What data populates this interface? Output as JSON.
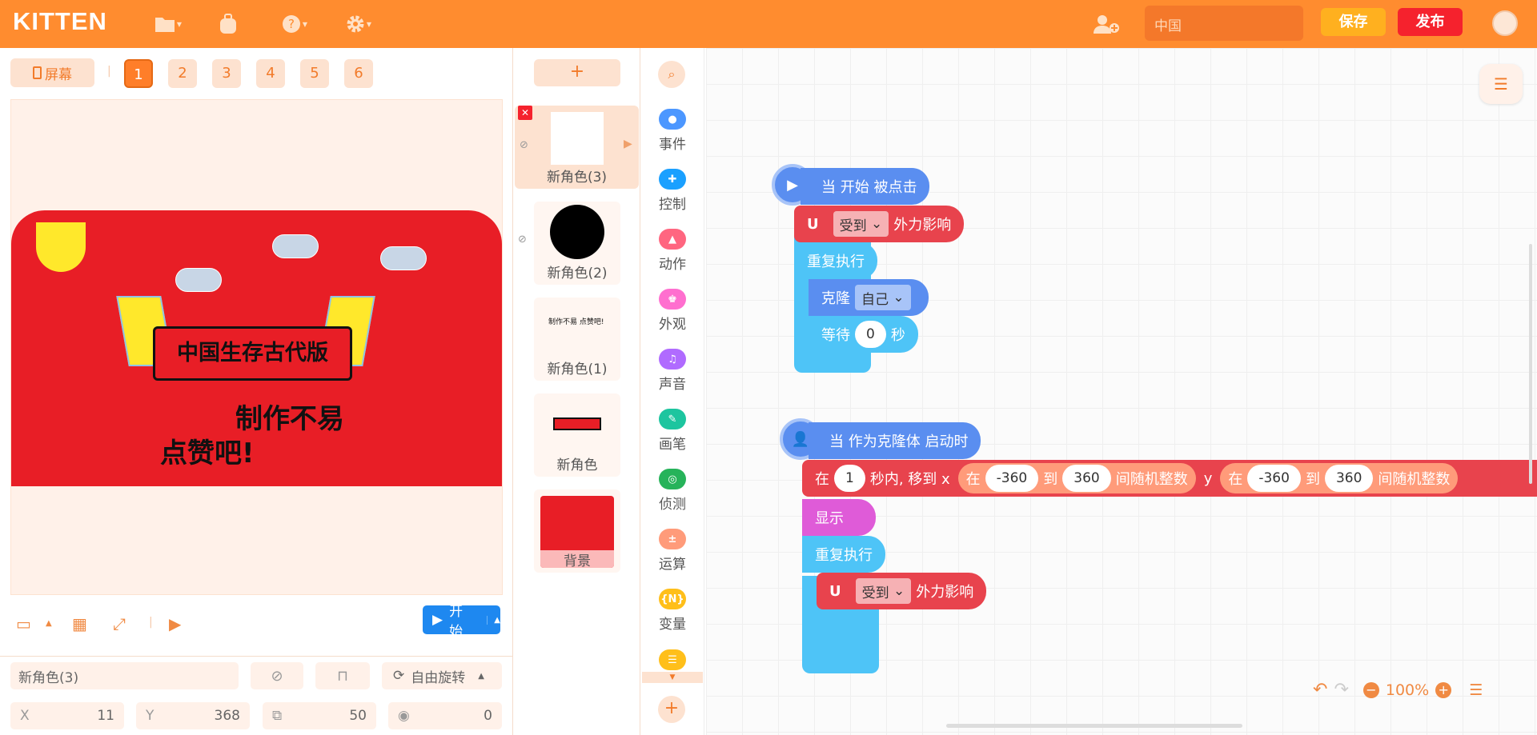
{
  "app": {
    "logo": "KITTEN",
    "project_name": "中国",
    "save_label": "保存",
    "publish_label": "发布"
  },
  "screens": {
    "label": "屏幕",
    "numbers": [
      "1",
      "2",
      "3",
      "4",
      "5",
      "6"
    ],
    "active": "1"
  },
  "stage": {
    "title_text": "中国生存古代版",
    "slogan_line1": "制作不易",
    "slogan_line2": "点赞吧!",
    "start_label": "开始"
  },
  "props": {
    "sprite_name": "新角色(3)",
    "rotation_label": "自由旋转",
    "x_label": "X",
    "x": "11",
    "y_label": "Y",
    "y": "368",
    "size": "50",
    "direction": "0"
  },
  "sprites": [
    {
      "label": "新角色(3)",
      "selected": true
    },
    {
      "label": "新角色(2)",
      "selected": false
    },
    {
      "label": "新角色(1)",
      "selected": false,
      "thumb_text": "制作不易 点赞吧!"
    },
    {
      "label": "新角色",
      "selected": false
    },
    {
      "label": "背景",
      "selected": false
    }
  ],
  "categories": [
    {
      "label": "事件",
      "color": "#4c97ff"
    },
    {
      "label": "控制",
      "color": "#1aa0ff"
    },
    {
      "label": "动作",
      "color": "#ff6680"
    },
    {
      "label": "外观",
      "color": "#ff6fcf"
    },
    {
      "label": "声音",
      "color": "#b06bff"
    },
    {
      "label": "画笔",
      "color": "#1dc59f"
    },
    {
      "label": "侦测",
      "color": "#26b35a"
    },
    {
      "label": "运算",
      "color": "#ff9b7a"
    },
    {
      "label": "变量",
      "color": "#ffbf1a"
    }
  ],
  "blocks": {
    "s1_hat": "当 开始 被点击",
    "s1_force_dd": "受到",
    "s1_force_tail": "外力影响",
    "s1_repeat": "重复执行",
    "s1_clone": "克隆",
    "s1_clone_dd": "自己",
    "s1_wait": "等待",
    "s1_wait_val": "0",
    "s1_wait_unit": "秒",
    "s2_hat": "当 作为克隆体 启动时",
    "s2_in": "在",
    "s2_secs": "1",
    "s2_move": "秒内, 移到 x",
    "s2_rand_in": "在",
    "s2_xmin": "-360",
    "s2_to": "到",
    "s2_xmax": "360",
    "s2_rand_tail": "间随机整数",
    "s2_y": "y",
    "s2_ymin": "-360",
    "s2_ymax": "360",
    "s2_show": "显示",
    "s2_repeat": "重复执行",
    "s2_force_dd": "受到",
    "s2_force_tail": "外力影响"
  },
  "zoom": {
    "level": "100%"
  }
}
